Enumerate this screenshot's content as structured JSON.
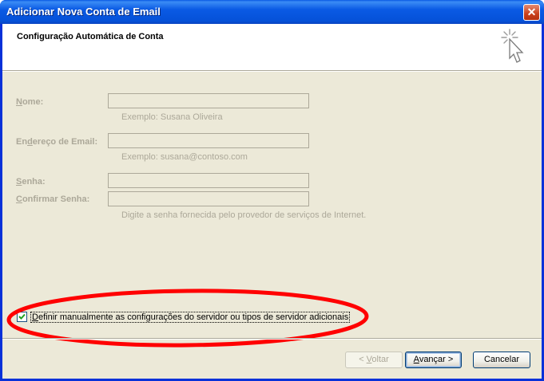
{
  "window": {
    "title": "Adicionar Nova Conta de Email",
    "close_label": "✕"
  },
  "header": {
    "title": "Configuração Automática de Conta",
    "icon": "cursor-sparkle-icon"
  },
  "form": {
    "name": {
      "label_u": "N",
      "label_rest": "ome:",
      "value": "",
      "hint": "Exemplo: Susana Oliveira"
    },
    "email": {
      "label_pre": "En",
      "label_u": "d",
      "label_rest": "ereço de Email:",
      "value": "",
      "hint": "Exemplo: susana@contoso.com"
    },
    "password": {
      "label_u": "S",
      "label_rest": "enha:",
      "value": ""
    },
    "confirm": {
      "label_u": "C",
      "label_rest": "onfirmar Senha:",
      "value": "",
      "hint": "Digite a senha fornecida pelo provedor de serviços de Internet."
    }
  },
  "manual_config": {
    "checked": true,
    "label_u": "D",
    "label_rest": "efinir manualmente as configurações do servidor ou tipos de servidor adicionais"
  },
  "annotation": {
    "color": "#ff0000"
  },
  "buttons": {
    "back": {
      "pre": "< ",
      "u": "V",
      "rest": "oltar",
      "disabled": true
    },
    "next": {
      "pre": "",
      "u": "A",
      "rest": "vançar >",
      "default": true
    },
    "cancel": {
      "label": "Cancelar"
    }
  },
  "colors": {
    "titlebar": "#0a5ae4",
    "dialog_bg": "#ece9d8",
    "disabled_text": "#aca899"
  }
}
